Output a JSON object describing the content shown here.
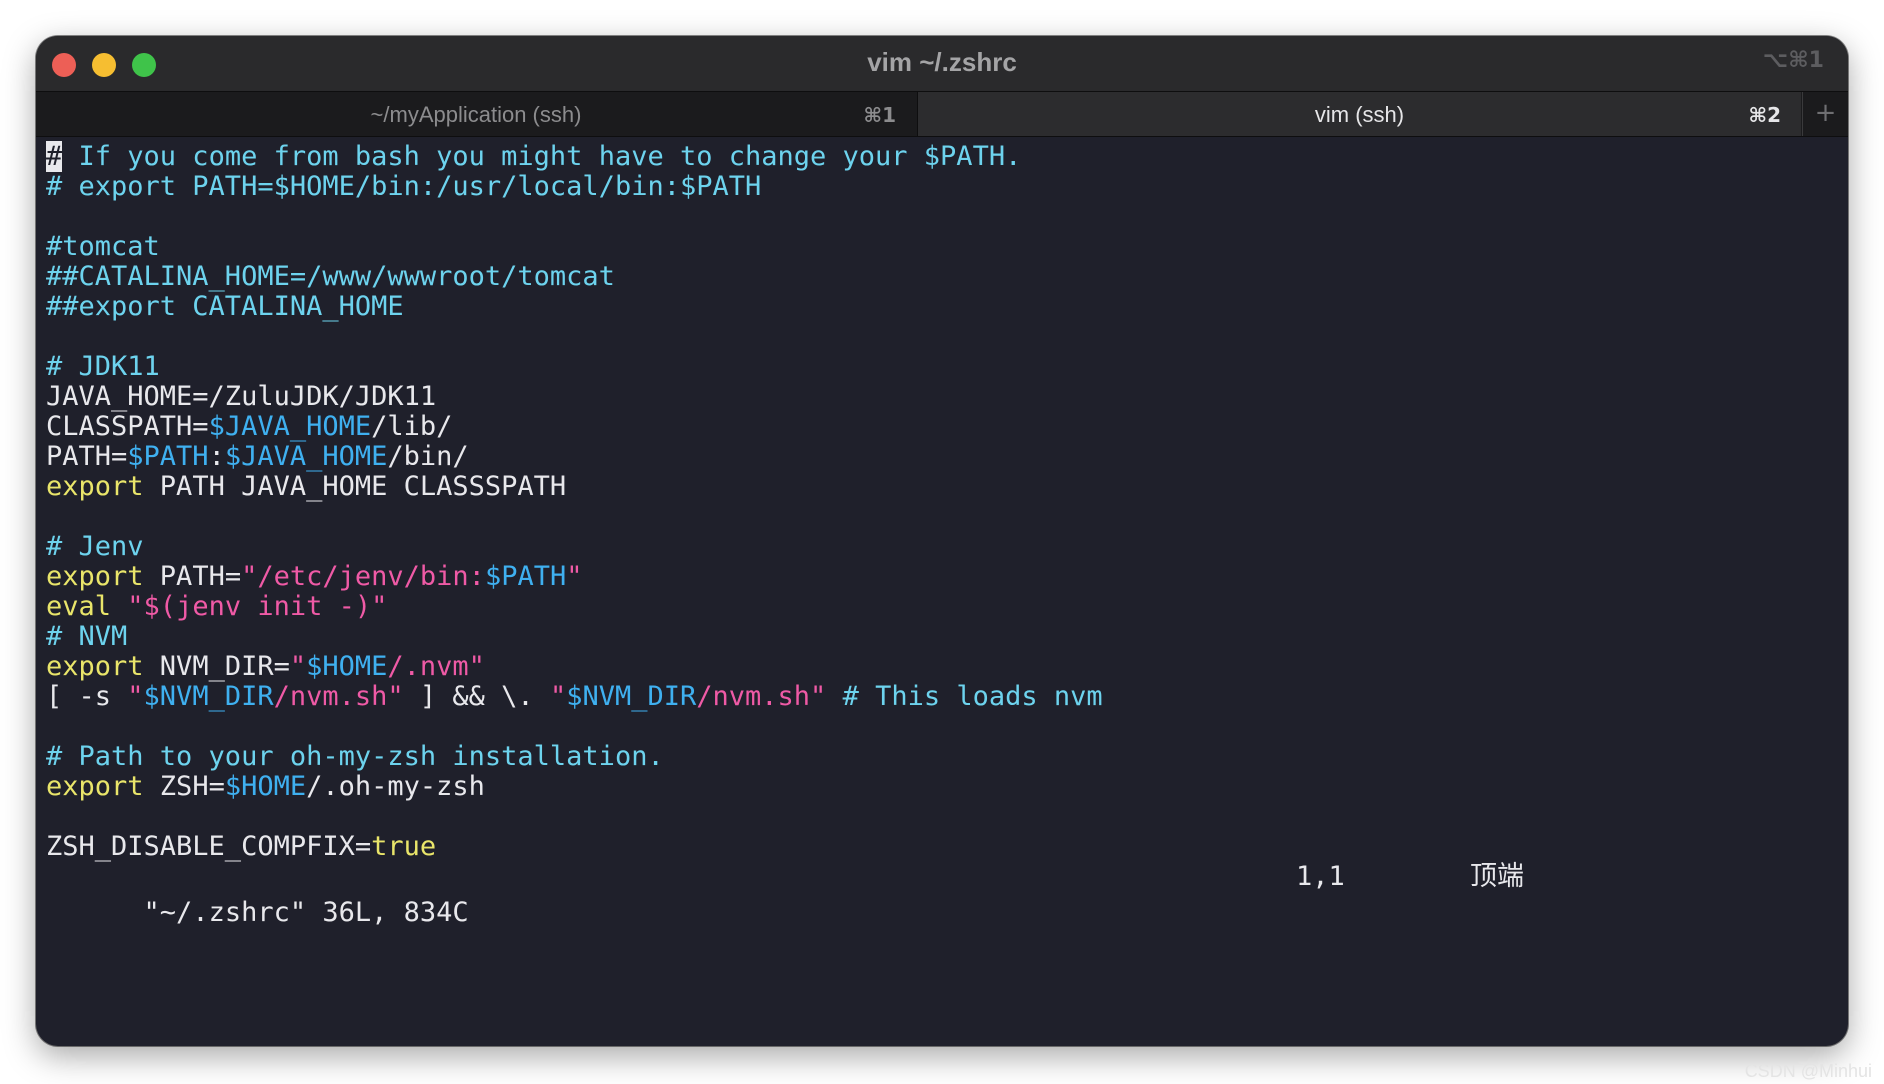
{
  "window": {
    "title": "vim ~/.zshrc",
    "title_shortcut": "⌥⌘1"
  },
  "tabs": [
    {
      "label": "~/myApplication (ssh)",
      "shortcut": "⌘1",
      "active": false
    },
    {
      "label": "vim (ssh)",
      "shortcut": "⌘2",
      "active": true
    }
  ],
  "new_tab_icon": "plus-icon",
  "colors": {
    "background": "#1f202b",
    "comment": "#6dd3ee",
    "keyword": "#e9e56a",
    "variable": "#3fb0f0",
    "string": "#ef5aa6",
    "text": "#e8e8ec"
  },
  "lines": [
    [
      [
        "comment",
        "#"
      ],
      [
        "comment",
        " If you come from bash you might have to change your $PATH."
      ]
    ],
    [
      [
        "comment",
        "# export PATH=$HOME/bin:/usr/local/bin:$PATH"
      ]
    ],
    [],
    [
      [
        "comment",
        "#tomcat"
      ]
    ],
    [
      [
        "comment",
        "##CATALINA_HOME=/www/wwwroot/tomcat"
      ]
    ],
    [
      [
        "comment",
        "##export CATALINA_HOME"
      ]
    ],
    [],
    [
      [
        "comment",
        "# JDK11"
      ]
    ],
    [
      [
        "plain",
        "JAVA_HOME=/ZuluJDK/JDK11"
      ]
    ],
    [
      [
        "plain",
        "CLASSPATH="
      ],
      [
        "var",
        "$JAVA_HOME"
      ],
      [
        "plain",
        "/lib/"
      ]
    ],
    [
      [
        "plain",
        "PATH="
      ],
      [
        "var",
        "$PATH"
      ],
      [
        "plain",
        ":"
      ],
      [
        "var",
        "$JAVA_HOME"
      ],
      [
        "plain",
        "/bin/"
      ]
    ],
    [
      [
        "keyword",
        "export"
      ],
      [
        "plain",
        " PATH JAVA_HOME CLASSSPATH"
      ]
    ],
    [],
    [
      [
        "comment",
        "# Jenv"
      ]
    ],
    [
      [
        "keyword",
        "export"
      ],
      [
        "plain",
        " PATH="
      ],
      [
        "string",
        "\"/etc/jenv/bin:"
      ],
      [
        "var",
        "$PATH"
      ],
      [
        "string",
        "\""
      ]
    ],
    [
      [
        "keyword",
        "eval"
      ],
      [
        "plain",
        " "
      ],
      [
        "string",
        "\"$(jenv init -)\""
      ]
    ],
    [
      [
        "comment",
        "# NVM"
      ]
    ],
    [
      [
        "keyword",
        "export"
      ],
      [
        "plain",
        " NVM_DIR="
      ],
      [
        "string",
        "\""
      ],
      [
        "var",
        "$HOME"
      ],
      [
        "string",
        "/.nvm\""
      ]
    ],
    [
      [
        "plain",
        "[ -s "
      ],
      [
        "string",
        "\""
      ],
      [
        "var",
        "$NVM_DIR"
      ],
      [
        "string",
        "/nvm.sh\""
      ],
      [
        "plain",
        " ] && \\. "
      ],
      [
        "string",
        "\""
      ],
      [
        "var",
        "$NVM_DIR"
      ],
      [
        "string",
        "/nvm.sh\""
      ],
      [
        "plain",
        " "
      ],
      [
        "comment",
        "# This loads nvm"
      ]
    ],
    [],
    [
      [
        "comment",
        "# Path to your oh-my-zsh installation."
      ]
    ],
    [
      [
        "keyword",
        "export"
      ],
      [
        "plain",
        " ZSH="
      ],
      [
        "var",
        "$HOME"
      ],
      [
        "plain",
        "/.oh-my-zsh"
      ]
    ],
    [],
    [
      [
        "plain",
        "ZSH_DISABLE_COMPFIX="
      ],
      [
        "keyword",
        "true"
      ]
    ]
  ],
  "status": {
    "file_info": "\"~/.zshrc\" 36L, 834C",
    "position": "1,1",
    "scroll": "顶端"
  },
  "watermark": "CSDN @Minhui"
}
